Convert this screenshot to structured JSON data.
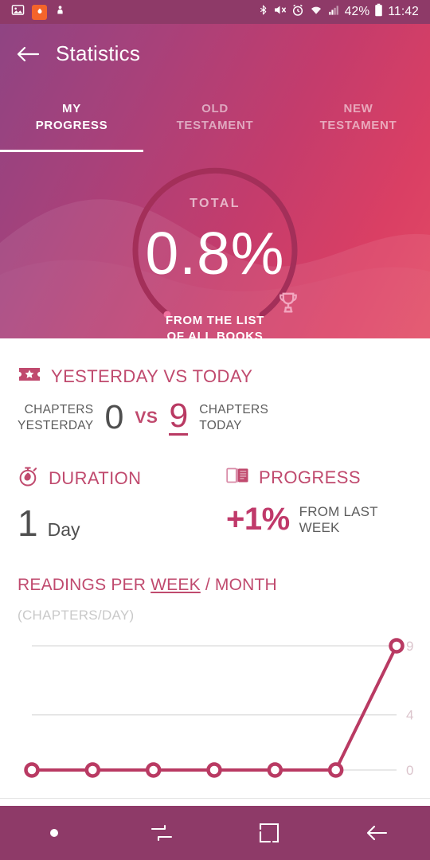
{
  "statusbar": {
    "icons": [
      "image-icon",
      "app-badge-icon",
      "download-icon",
      "bluetooth-icon",
      "mute-icon",
      "alarm-icon",
      "wifi-icon",
      "signal-icon"
    ],
    "battery_percent": "42%",
    "time": "11:42",
    "bg_color": "#8e3a68"
  },
  "header": {
    "title": "Statistics",
    "back_icon": "arrow-left-icon",
    "gradient_from": "#8f4483",
    "gradient_to": "#e24a63",
    "tabs": [
      {
        "line1": "MY",
        "line2": "PROGRESS",
        "active": true
      },
      {
        "line1": "OLD",
        "line2": "TESTAMENT",
        "active": false
      },
      {
        "line1": "NEW",
        "line2": "TESTAMENT",
        "active": false
      }
    ],
    "circle": {
      "label": "TOTAL",
      "value": "0.8%",
      "sub_line1": "FROM THE LIST",
      "sub_line2": "OF ALL BOOKS",
      "trophy_icon": "trophy-icon",
      "percent": 0.8,
      "track_color": "#a32f59",
      "cap_color": "#f0709e"
    }
  },
  "yesterday_vs_today": {
    "icon": "ticket-star-icon",
    "title": "YESTERDAY VS TODAY",
    "left_label_line1": "CHAPTERS",
    "left_label_line2": "YESTERDAY",
    "left_value": "0",
    "vs": "VS",
    "right_value": "9",
    "right_label_line1": "CHAPTERS",
    "right_label_line2": "TODAY"
  },
  "duration": {
    "icon": "stopwatch-icon",
    "title": "DURATION",
    "value": "1",
    "unit": "Day"
  },
  "progress": {
    "icon": "open-book-icon",
    "title": "PROGRESS",
    "value": "+1%",
    "note_line1": "FROM LAST",
    "note_line2": "WEEK"
  },
  "chart_section": {
    "title_prefix": "READINGS PER ",
    "title_underlined": "WEEK",
    "title_suffix": " / MONTH",
    "subtitle": "(CHAPTERS/DAY)"
  },
  "chart_data": {
    "type": "line",
    "title": "READINGS PER WEEK / MONTH",
    "ylabel": "(CHAPTERS/DAY)",
    "xlabel": "",
    "x": [
      1,
      2,
      3,
      4,
      5,
      6,
      7
    ],
    "categories": [
      "",
      "",
      "",
      "",
      "",
      "",
      ""
    ],
    "values": [
      0,
      0,
      0,
      0,
      0,
      0,
      9
    ],
    "ylim": [
      0,
      9
    ],
    "ytick_labels": [
      "0",
      "4",
      "9"
    ],
    "ytick_values": [
      0,
      4,
      9
    ],
    "grid": true,
    "grid_axis": "y",
    "legend": false,
    "line_color": "#b93a63",
    "marker": "circle-open",
    "tick_label_color": "#dbc4cc"
  },
  "navbar": {
    "buttons": [
      "dot-icon",
      "toggle-icon",
      "square-recents-icon",
      "back-arrow-icon"
    ],
    "bg_color": "#8e3a68"
  }
}
